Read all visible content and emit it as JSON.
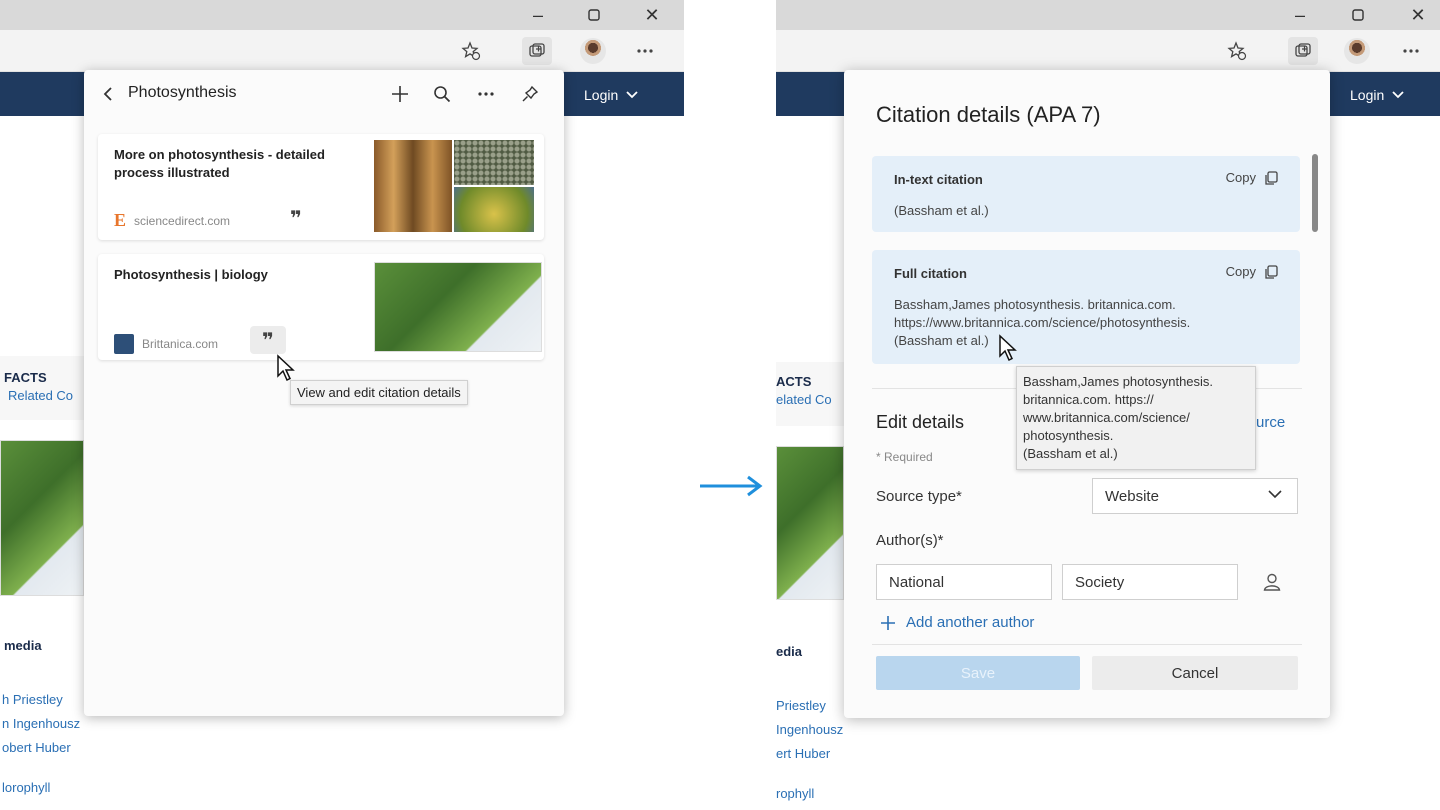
{
  "left_screen": {
    "login_label": "Login",
    "collections": {
      "title": "Photosynthesis",
      "items": [
        {
          "title": "More on photosynthesis - detailed process illustrated",
          "source": "sciencedirect.com",
          "source_icon": "E"
        },
        {
          "title": "Photosynthesis | biology",
          "source": "Brittanica.com"
        }
      ],
      "tooltip": "View and edit citation details"
    },
    "background": {
      "facts": "FACTS",
      "related": "Related Co",
      "media": "media",
      "links": [
        "h Priestley",
        "n Ingenhousz",
        "obert Huber",
        "lorophyll"
      ]
    }
  },
  "right_screen": {
    "login_label": "Login",
    "citation": {
      "title": "Citation details (APA 7)",
      "in_text": {
        "label": "In-text citation",
        "copy_label": "Copy",
        "text": "(Bassham et al.)"
      },
      "full": {
        "label": "Full citation",
        "copy_label": "Copy",
        "line1": "Bassham,James photosynthesis. britannica.com.",
        "line2": "https://www.britannica.com/science/photosynthesis.",
        "line3": "(Bassham et al.)"
      },
      "tooltip_lines": [
        "Bassham,James photosynthesis.",
        "britannica.com. https://",
        "www.britannica.com/science/",
        "photosynthesis.",
        "(Bassham et al.)"
      ],
      "edit_title": "Edit details",
      "source_link": "urce",
      "required_note": "* Required",
      "source_type_label": "Source type*",
      "source_type_value": "Website",
      "authors_label": "Author(s)*",
      "author_first": "National",
      "author_last": "Society",
      "add_author": "Add another author",
      "save_label": "Save",
      "cancel_label": "Cancel"
    },
    "background": {
      "facts": "ACTS",
      "related": "elated Co",
      "media": "edia",
      "links": [
        "Priestley",
        "Ingenhousz",
        "ert Huber",
        "rophyll"
      ]
    }
  },
  "colors": {
    "site_nav": "#1f3a5f",
    "citation_box": "#e4eff9",
    "link": "#2a6fb4",
    "flow_arrow": "#1f8fdc"
  }
}
